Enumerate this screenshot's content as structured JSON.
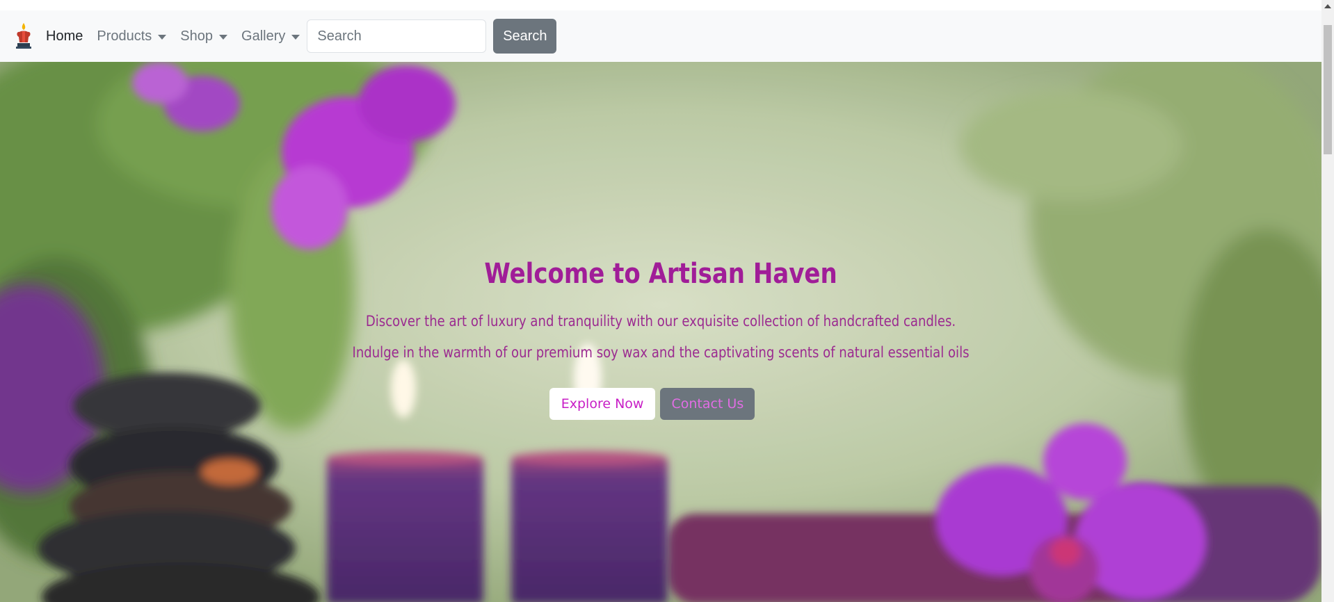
{
  "navbar": {
    "brand_icon": "candle-logo-icon",
    "links": [
      {
        "label": "Home",
        "active": true,
        "dropdown": false
      },
      {
        "label": "Products",
        "active": false,
        "dropdown": true
      },
      {
        "label": "Shop",
        "active": false,
        "dropdown": true
      },
      {
        "label": "Gallery",
        "active": false,
        "dropdown": true
      }
    ],
    "search_placeholder": "Search",
    "search_button": "Search"
  },
  "hero": {
    "title": "Welcome to Artisan Haven",
    "line1": "Discover the art of luxury and tranquility with our exquisite collection of handcrafted candles.",
    "line2": "Indulge in the warmth of our premium soy wax and the captivating scents of natural essential oils",
    "explore_button": "Explore Now",
    "contact_button": "Contact Us"
  },
  "colors": {
    "title": "#a01d98",
    "text": "#9b2a90",
    "navbar_bg": "#f8f9fa",
    "button_secondary": "#6c757d",
    "accent": "#c81fc6"
  }
}
